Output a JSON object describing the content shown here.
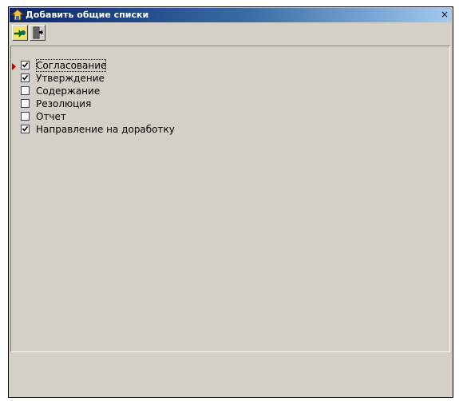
{
  "window": {
    "title": "Добавить общие списки",
    "close_glyph": "×"
  },
  "toolbar": {
    "buttons": [
      {
        "icon": "add-enter-icon"
      },
      {
        "icon": "exit-door-icon"
      }
    ]
  },
  "list": {
    "items": [
      {
        "label": "Согласование",
        "checked": true,
        "current": true
      },
      {
        "label": "Утверждение",
        "checked": true,
        "current": false
      },
      {
        "label": "Содержание",
        "checked": false,
        "current": false
      },
      {
        "label": "Резолюция",
        "checked": false,
        "current": false
      },
      {
        "label": "Отчет",
        "checked": false,
        "current": false
      },
      {
        "label": "Направление на доработку",
        "checked": true,
        "current": false
      }
    ]
  },
  "colors": {
    "window_bg": "#d4d0c8",
    "titlebar_start": "#0a246a",
    "titlebar_end": "#a6caf0",
    "current_row_marker": "#cc0000"
  }
}
